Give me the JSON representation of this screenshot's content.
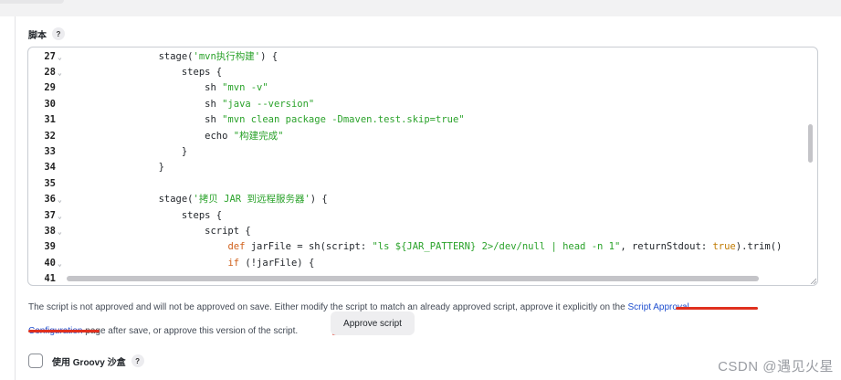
{
  "field": {
    "label": "脚本",
    "help": "?"
  },
  "editor": {
    "lines": [
      {
        "num": "27",
        "fold": "⌄",
        "parts": [
          {
            "t": "        stage("
          },
          {
            "t": "'mvn执行构建'",
            "c": "str"
          },
          {
            "t": ") {"
          }
        ]
      },
      {
        "num": "28",
        "fold": "⌄",
        "parts": [
          {
            "t": "            steps {"
          }
        ]
      },
      {
        "num": "29",
        "fold": "",
        "parts": [
          {
            "t": "                sh "
          },
          {
            "t": "\"mvn -v\"",
            "c": "str"
          }
        ]
      },
      {
        "num": "30",
        "fold": "",
        "parts": [
          {
            "t": "                sh "
          },
          {
            "t": "\"java --version\"",
            "c": "str"
          }
        ]
      },
      {
        "num": "31",
        "fold": "",
        "parts": [
          {
            "t": "                sh "
          },
          {
            "t": "\"mvn clean package -Dmaven.test.skip=true\"",
            "c": "str"
          }
        ]
      },
      {
        "num": "32",
        "fold": "",
        "parts": [
          {
            "t": "                echo "
          },
          {
            "t": "\"构建完成\"",
            "c": "str"
          }
        ]
      },
      {
        "num": "33",
        "fold": "",
        "parts": [
          {
            "t": "            }"
          }
        ]
      },
      {
        "num": "34",
        "fold": "",
        "parts": [
          {
            "t": "        }"
          }
        ]
      },
      {
        "num": "35",
        "fold": "",
        "parts": [
          {
            "t": ""
          }
        ]
      },
      {
        "num": "36",
        "fold": "⌄",
        "parts": [
          {
            "t": "        stage("
          },
          {
            "t": "'拷贝 JAR 到远程服务器'",
            "c": "str"
          },
          {
            "t": ") {"
          }
        ]
      },
      {
        "num": "37",
        "fold": "⌄",
        "parts": [
          {
            "t": "            steps {"
          }
        ]
      },
      {
        "num": "38",
        "fold": "⌄",
        "parts": [
          {
            "t": "                script {"
          }
        ]
      },
      {
        "num": "39",
        "fold": "",
        "parts": [
          {
            "t": "                    "
          },
          {
            "t": "def",
            "c": "def"
          },
          {
            "t": " jarFile = sh(script: "
          },
          {
            "t": "\"ls ${JAR_PATTERN} 2>/dev/null | head -n 1\"",
            "c": "str"
          },
          {
            "t": ", returnStdout: "
          },
          {
            "t": "true",
            "c": "bool"
          },
          {
            "t": ").trim()"
          }
        ]
      },
      {
        "num": "40",
        "fold": "⌄",
        "parts": [
          {
            "t": "                    "
          },
          {
            "t": "if",
            "c": "def"
          },
          {
            "t": " (!jarFile) {"
          }
        ]
      },
      {
        "num": "41",
        "fold": "",
        "parts": [
          {
            "t": ""
          }
        ]
      }
    ]
  },
  "notice": {
    "text_before": "The script is not approved and will not be approved on save. Either modify the script to match an already approved script, approve it explicitly on th",
    "text_e": "e ",
    "link_part1": "Script Approval",
    "link_part2": "Configuration",
    "text_after": " page after save, or approve this version of the script."
  },
  "approve_button": {
    "label": "Approve script"
  },
  "sandbox": {
    "label": "使用 Groovy 沙盒",
    "help": "?",
    "checked": false
  },
  "watermark": {
    "text": "CSDN @遇见火星"
  },
  "colors": {
    "string": "#2aa22a",
    "keyword": "#d0601a",
    "link": "#1f4fcf",
    "highlight_underline": "#e0301e"
  }
}
